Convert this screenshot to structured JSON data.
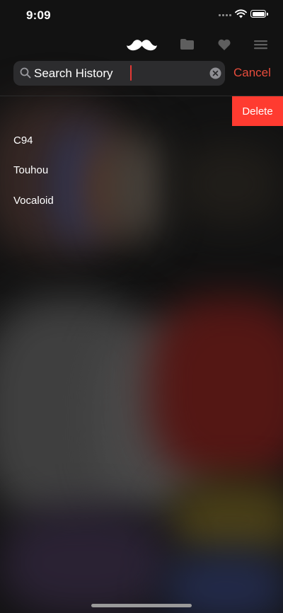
{
  "status_bar": {
    "time": "9:09"
  },
  "toolbar": {
    "icons": [
      "mustache-logo-icon",
      "folder-icon",
      "heart-icon",
      "menu-icon"
    ]
  },
  "search": {
    "placeholder": "Search History",
    "value": "",
    "cancel_label": "Cancel"
  },
  "history": {
    "delete_label": "Delete",
    "items": [
      {
        "label": ""
      },
      {
        "label": "C94"
      },
      {
        "label": "Touhou"
      },
      {
        "label": "Vocaloid"
      }
    ]
  },
  "colors": {
    "accent": "#e74c3c",
    "delete": "#ff3b30",
    "background": "#141414",
    "field": "#2c2c2e"
  }
}
